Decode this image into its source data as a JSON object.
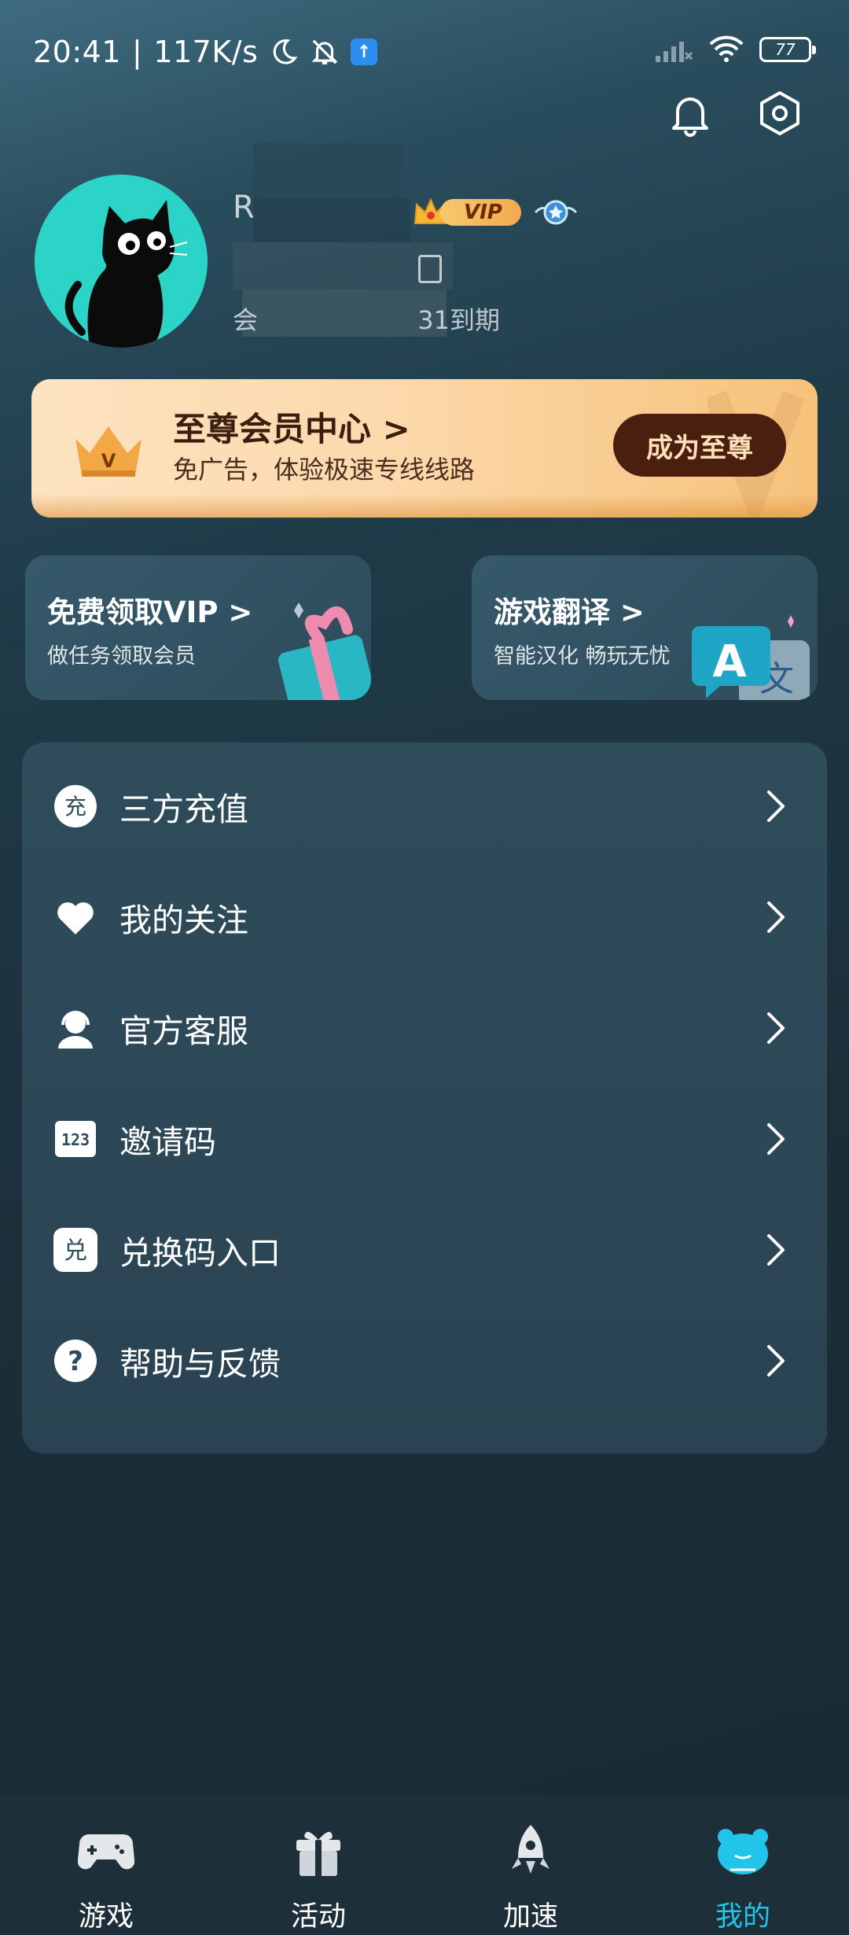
{
  "status_bar": {
    "time": "20:41",
    "separator": "|",
    "net_speed": "117K/s",
    "battery": "77"
  },
  "header": {
    "notifications_icon": "bell-icon",
    "settings_icon": "hexagon-settings-icon"
  },
  "profile": {
    "username_visible": "R",
    "vip_label": "VIP",
    "expire_prefix": "会",
    "expire_suffix": "31到期"
  },
  "supreme": {
    "title": "至尊会员中心 >",
    "subtitle": "免广告，体验极速专线线路",
    "button": "成为至尊"
  },
  "promos": [
    {
      "title": "免费领取VIP >",
      "subtitle": "做任务领取会员"
    },
    {
      "title": "游戏翻译 >",
      "subtitle": "智能汉化 畅玩无忧"
    }
  ],
  "menu": [
    {
      "label": "三方充值",
      "icon": "recharge-icon"
    },
    {
      "label": "我的关注",
      "icon": "heart-icon"
    },
    {
      "label": "官方客服",
      "icon": "customer-service-icon"
    },
    {
      "label": "邀请码",
      "icon": "code-123-icon"
    },
    {
      "label": "兑换码入口",
      "icon": "redeem-icon"
    },
    {
      "label": "帮助与反馈",
      "icon": "help-icon"
    }
  ],
  "bottom_nav": [
    {
      "label": "游戏",
      "icon": "gamepad-icon",
      "active": false
    },
    {
      "label": "活动",
      "icon": "gift-icon",
      "active": false
    },
    {
      "label": "加速",
      "icon": "rocket-icon",
      "active": false
    },
    {
      "label": "我的",
      "icon": "mascot-icon",
      "active": true
    }
  ],
  "colors": {
    "accent": "#21c5ea",
    "supreme_button": "#4a1f10",
    "avatar_bg": "#2cd3c7"
  }
}
